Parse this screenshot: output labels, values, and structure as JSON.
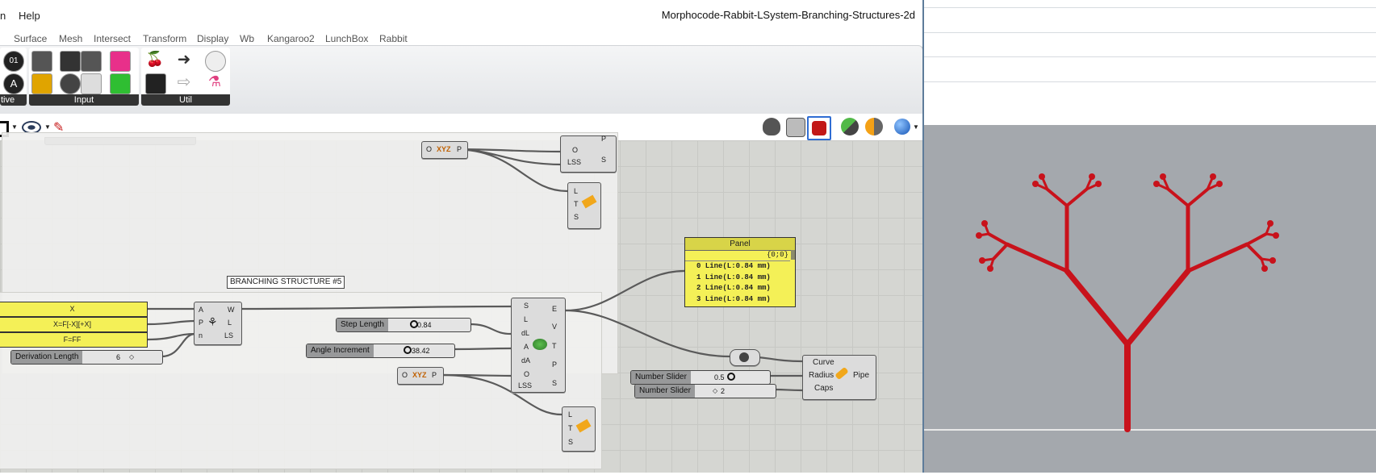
{
  "menubar": {
    "items": [
      "n",
      "Help"
    ],
    "title": "Morphocode-Rabbit-LSystem-Branching-Structures-2d"
  },
  "tabs": [
    "Surface",
    "Mesh",
    "Intersect",
    "Transform",
    "Display",
    "Wb",
    "Kangaroo2",
    "LunchBox",
    "Rabbit"
  ],
  "ribbon": {
    "groups": [
      "tive",
      "Input",
      "Util"
    ]
  },
  "canvas": {
    "group_label": "BRANCHING STRUCTURE #5",
    "axiom_panels": [
      "X",
      "X=F[-X][+X]",
      "F=FF"
    ],
    "derivation": {
      "label": "Derivation Length",
      "value": "6"
    },
    "lsystem_component": {
      "inputs": [
        "A",
        "P",
        "n"
      ],
      "outputs": [
        "W",
        "L",
        "LS"
      ]
    },
    "step_length": {
      "label": "Step Length",
      "value": "0.84"
    },
    "angle_increment": {
      "label": "Angle Increment",
      "value": "38.42"
    },
    "plane_component": {
      "input": "O",
      "glyph": "XYZ",
      "output": "P"
    },
    "turtle_component": {
      "inputs": [
        "S",
        "L",
        "dL",
        "A",
        "dA",
        "O",
        "LSS"
      ],
      "outputs": [
        "E",
        "V",
        "T",
        "P",
        "S"
      ]
    },
    "turtle_top": {
      "inputs": [
        "O",
        "LSS"
      ],
      "outputs": [
        "P",
        "S"
      ]
    },
    "split_component": {
      "inputs": [
        "L",
        "T",
        "S"
      ]
    },
    "output_panel": {
      "title": "Panel",
      "path": "{0;0}",
      "rows": [
        "0 Line(L:0.84 mm)",
        "1 Line(L:0.84 mm)",
        "2 Line(L:0.84 mm)",
        "3 Line(L:0.84 mm)"
      ]
    },
    "slider_radius": {
      "label": "Number Slider",
      "value": "0.5"
    },
    "slider_caps": {
      "label": "Number Slider",
      "value": "2"
    },
    "pipe_component": {
      "inputs": [
        "Curve",
        "Radius",
        "Caps"
      ],
      "output": "Pipe"
    }
  },
  "colors": {
    "panel_yellow": "#f4f057",
    "tree_red": "#c8121b",
    "viewport_bg": "#a4a8ad"
  }
}
